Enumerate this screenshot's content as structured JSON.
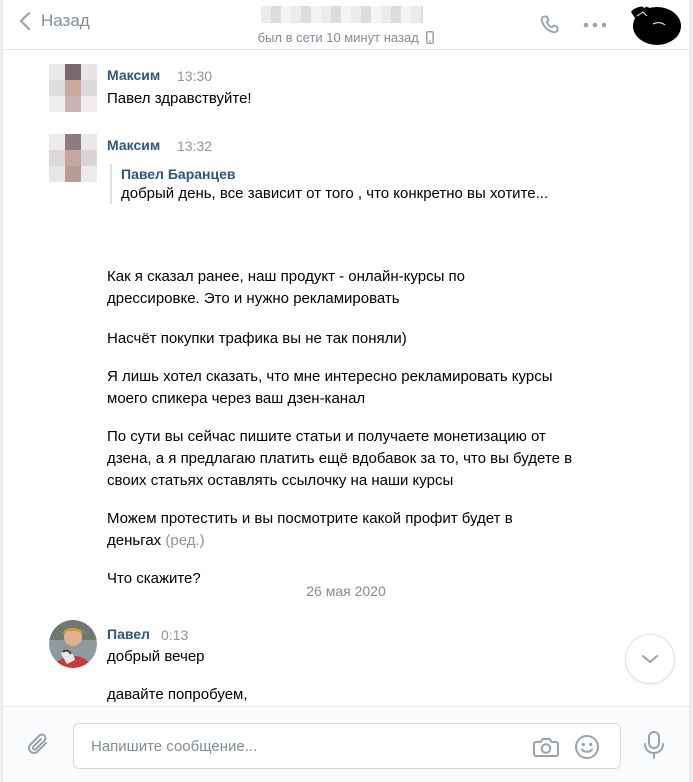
{
  "header": {
    "back_label": "Назад",
    "status": "был в сети 10 минут назад"
  },
  "messages": [
    {
      "author": "Максим",
      "time": "13:30",
      "text": "Павел здравствуйте!"
    },
    {
      "author": "Максим",
      "time": "13:32",
      "quote_author": "Павел Баранцев",
      "quote_text": "добрый день, все зависит от того , что конкретно вы хотите...",
      "paragraphs": [
        "Как я сказал ранее, наш продукт - онлайн-курсы по дрессировке. Это и нужно рекламировать",
        "Насчёт покупки трафика вы не так поняли)",
        "Я лишь хотел сказать, что мне интересно рекламировать курсы моего спикера через ваш дзен-канал",
        "По сути вы сейчас пишите статьи и получаете монетизацию от дзена, а я предлагаю платить ещё вдобавок за то, что вы будете в своих статьях оставлять ссылочку на наши курсы",
        "Можем протестить и вы посмотрите какой профит будет в деньгах",
        "Что скажите?"
      ],
      "edited_label": "(ред.)"
    }
  ],
  "date_separator": "26 мая 2020",
  "reply": {
    "author": "Павел",
    "time": "0:13",
    "text1": "добрый вечер",
    "text2": "давайте попробуем,"
  },
  "composer": {
    "placeholder": "Напишите сообщение..."
  },
  "icons": {
    "back": "chevron-left-icon",
    "call": "phone-icon",
    "more": "more-dots-icon",
    "device": "mobile-icon",
    "scroll": "chevron-down-icon",
    "attach": "paperclip-icon",
    "camera": "camera-icon",
    "smile": "smile-icon",
    "mic": "microphone-icon"
  },
  "colors": {
    "link": "#2a5885",
    "muted": "#818c99",
    "border": "#e7e8ec",
    "icon": "#99a2ad"
  }
}
